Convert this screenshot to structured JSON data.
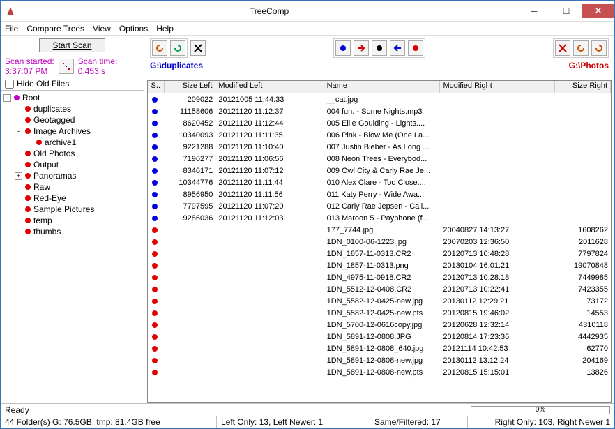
{
  "title": "TreeComp",
  "menu": [
    "File",
    "Compare Trees",
    "View",
    "Options",
    "Help"
  ],
  "left": {
    "scan_btn": "Start Scan",
    "scan_started_label": "Scan started:",
    "scan_started_val": "3:37:07 PM",
    "scan_time_label": "Scan time:",
    "scan_time_val": "0.453 s",
    "hide_label": "Hide Old Files",
    "tree": [
      {
        "d": 0,
        "tog": "-",
        "c": "mag",
        "t": "Root"
      },
      {
        "d": 1,
        "c": "red",
        "t": "duplicates"
      },
      {
        "d": 1,
        "c": "red",
        "t": "Geotagged"
      },
      {
        "d": 1,
        "tog": "-",
        "c": "red",
        "t": "Image Archives"
      },
      {
        "d": 2,
        "c": "red",
        "t": "archive1"
      },
      {
        "d": 1,
        "c": "red",
        "t": "Old Photos"
      },
      {
        "d": 1,
        "c": "red",
        "t": "Output"
      },
      {
        "d": 1,
        "tog": "+",
        "c": "red",
        "t": "Panoramas"
      },
      {
        "d": 1,
        "c": "red",
        "t": "Raw"
      },
      {
        "d": 1,
        "c": "red",
        "t": "Red-Eye"
      },
      {
        "d": 1,
        "c": "red",
        "t": "Sample Pictures"
      },
      {
        "d": 1,
        "c": "red",
        "t": "temp"
      },
      {
        "d": 1,
        "c": "red",
        "t": "thumbs"
      }
    ]
  },
  "paths": {
    "left": "G:\\duplicates",
    "right": "G:\\Photos"
  },
  "columns": [
    "S..",
    "Size Left",
    "Modified Left",
    "Name",
    "Modified Right",
    "Size Right"
  ],
  "rows": [
    {
      "c": "blue",
      "sl": "209022",
      "ml": "20121005 11:44:33",
      "nm": "__cat.jpg",
      "mr": "",
      "sr": ""
    },
    {
      "c": "blue",
      "sl": "11158606",
      "ml": "20121120 11:12:37",
      "nm": "004 fun. - Some Nights.mp3",
      "mr": "",
      "sr": ""
    },
    {
      "c": "blue",
      "sl": "8620452",
      "ml": "20121120 11:12:44",
      "nm": "005 Ellie Goulding - Lights....",
      "mr": "",
      "sr": ""
    },
    {
      "c": "blue",
      "sl": "10340093",
      "ml": "20121120 11:11:35",
      "nm": "006 Pink - Blow Me (One La...",
      "mr": "",
      "sr": ""
    },
    {
      "c": "blue",
      "sl": "9221288",
      "ml": "20121120 11:10:40",
      "nm": "007 Justin Bieber - As Long ...",
      "mr": "",
      "sr": ""
    },
    {
      "c": "blue",
      "sl": "7196277",
      "ml": "20121120 11:06:56",
      "nm": "008 Neon Trees - Everybod...",
      "mr": "",
      "sr": ""
    },
    {
      "c": "blue",
      "sl": "8346171",
      "ml": "20121120 11:07:12",
      "nm": "009 Owl City & Carly Rae Je...",
      "mr": "",
      "sr": ""
    },
    {
      "c": "blue",
      "sl": "10344776",
      "ml": "20121120 11:11:44",
      "nm": "010 Alex Clare - Too Close....",
      "mr": "",
      "sr": ""
    },
    {
      "c": "blue",
      "sl": "8956950",
      "ml": "20121120 11:11:56",
      "nm": "011 Katy Perry - Wide Awa...",
      "mr": "",
      "sr": ""
    },
    {
      "c": "blue",
      "sl": "7797595",
      "ml": "20121120 11:07:20",
      "nm": "012 Carly Rae Jepsen - Call...",
      "mr": "",
      "sr": ""
    },
    {
      "c": "blue",
      "sl": "9286036",
      "ml": "20121120 11:12:03",
      "nm": "013 Maroon 5 - Payphone (f...",
      "mr": "",
      "sr": ""
    },
    {
      "c": "red",
      "sl": "",
      "ml": "",
      "nm": "177_7744.jpg",
      "mr": "20040827 14:13:27",
      "sr": "1608262"
    },
    {
      "c": "red",
      "sl": "",
      "ml": "",
      "nm": "1DN_0100-06-1223.jpg",
      "mr": "20070203 12:36:50",
      "sr": "2011628"
    },
    {
      "c": "red",
      "sl": "",
      "ml": "",
      "nm": "1DN_1857-11-0313.CR2",
      "mr": "20120713 10:48:28",
      "sr": "7797824"
    },
    {
      "c": "red",
      "sl": "",
      "ml": "",
      "nm": "1DN_1857-11-0313.png",
      "mr": "20130104 16:01:21",
      "sr": "19070848"
    },
    {
      "c": "red",
      "sl": "",
      "ml": "",
      "nm": "1DN_4975-11-0918.CR2",
      "mr": "20120713 10:28:18",
      "sr": "7449985"
    },
    {
      "c": "red",
      "sl": "",
      "ml": "",
      "nm": "1DN_5512-12-0408.CR2",
      "mr": "20120713 10:22:41",
      "sr": "7423355"
    },
    {
      "c": "red",
      "sl": "",
      "ml": "",
      "nm": "1DN_5582-12-0425-new.jpg",
      "mr": "20130112 12:29:21",
      "sr": "73172"
    },
    {
      "c": "red",
      "sl": "",
      "ml": "",
      "nm": "1DN_5582-12-0425-new.pts",
      "mr": "20120815 19:46:02",
      "sr": "14553"
    },
    {
      "c": "red",
      "sl": "",
      "ml": "",
      "nm": "1DN_5700-12-0616copy.jpg",
      "mr": "20120628 12:32:14",
      "sr": "4310118"
    },
    {
      "c": "red",
      "sl": "",
      "ml": "",
      "nm": "1DN_5891-12-0808.JPG",
      "mr": "20120814 17:23:36",
      "sr": "4442935"
    },
    {
      "c": "red",
      "sl": "",
      "ml": "",
      "nm": "1DN_5891-12-0808_640.jpg",
      "mr": "20121114 10:42:53",
      "sr": "62770"
    },
    {
      "c": "red",
      "sl": "",
      "ml": "",
      "nm": "1DN_5891-12-0808-new.jpg",
      "mr": "20130112 13:12:24",
      "sr": "204169"
    },
    {
      "c": "red",
      "sl": "",
      "ml": "",
      "nm": "1DN_5891-12-0808-new.pts",
      "mr": "20120815 15:15:01",
      "sr": "13826"
    }
  ],
  "status1": {
    "ready": "Ready",
    "progress": "0%"
  },
  "status2": {
    "folders": "44 Folder(s) G: 76.5GB, tmp: 81.4GB free",
    "left": "Left Only: 13, Left Newer: 1",
    "same": "Same/Filtered: 17",
    "right": "Right Only: 103, Right Newer 1"
  }
}
